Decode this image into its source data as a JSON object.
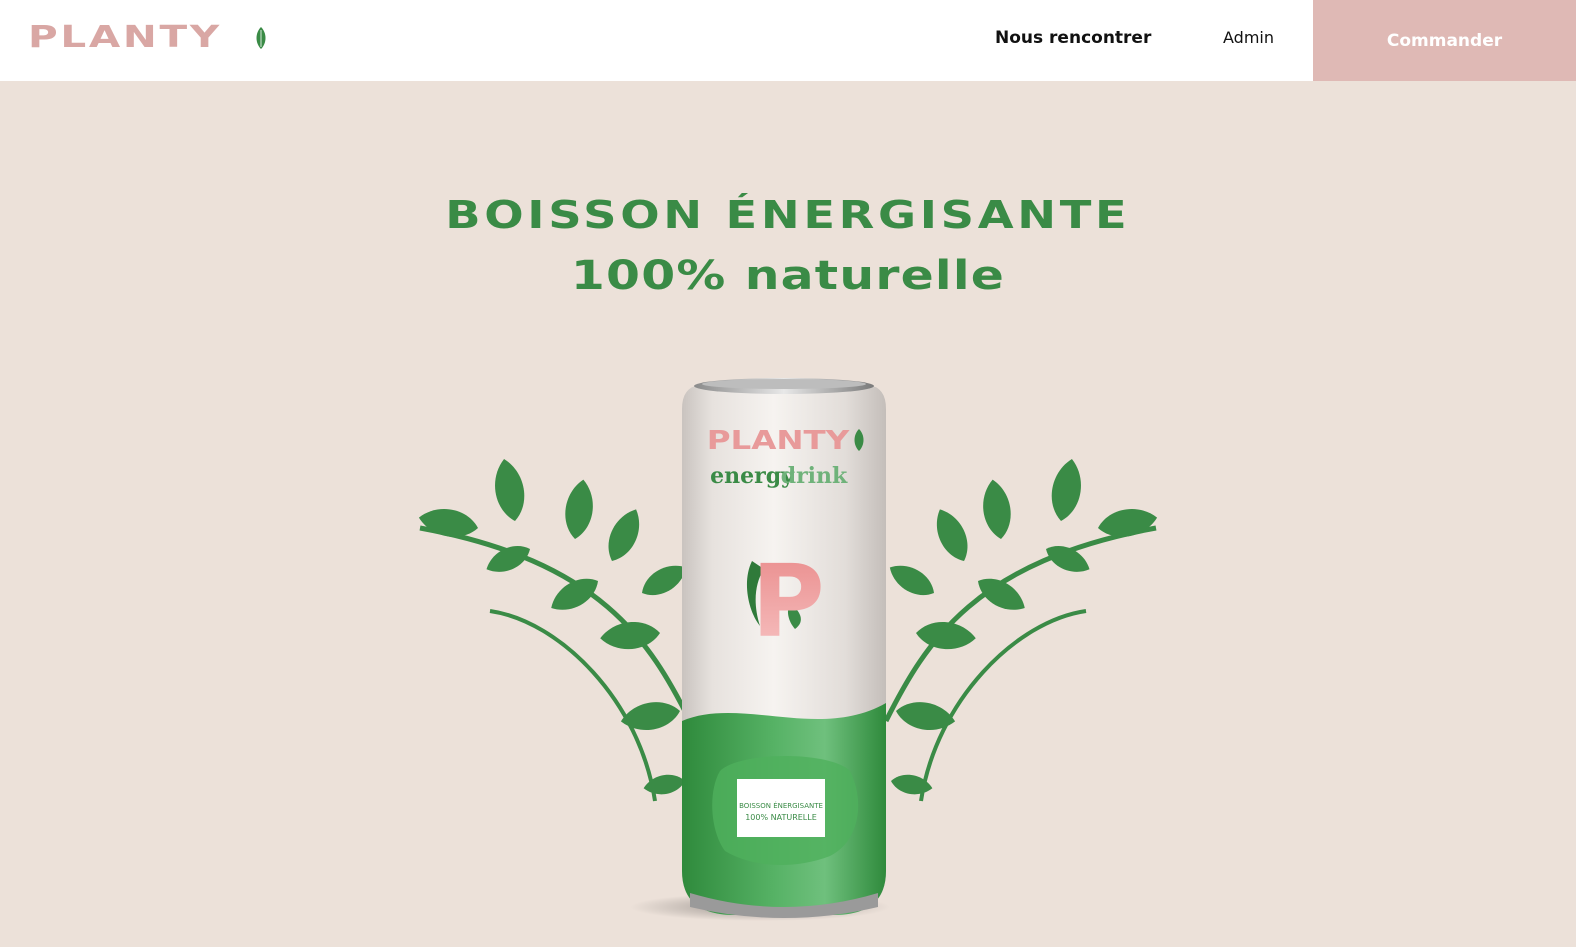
{
  "header": {
    "logo_text": "PLANTY",
    "nav": {
      "about_label": "Nous rencontrer",
      "admin_label": "Admin"
    },
    "order_label": "Commander"
  },
  "hero": {
    "title_line1": "BOISSON ÉNERGISANTE",
    "title_line2": "100% naturelle",
    "can": {
      "brand": "PLANTY",
      "subtitle_left": "energy",
      "subtitle_right": "drink",
      "letter": "P",
      "label_line1": "BOISSON ÉNERGISANTE",
      "label_line2": "100% NATURELLE"
    }
  },
  "colors": {
    "brand_pink": "#d9a7a4",
    "button_pink": "#dfb9b5",
    "green": "#3a8b46",
    "background": "#ece1d9"
  }
}
